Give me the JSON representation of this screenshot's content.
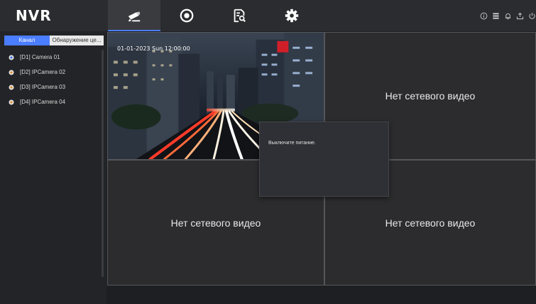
{
  "app": {
    "logo": "NVR"
  },
  "nav": {
    "tabs": [
      {
        "name": "live-view",
        "icon": "camera-icon",
        "active": true
      },
      {
        "name": "playback",
        "icon": "playback-icon",
        "active": false
      },
      {
        "name": "search",
        "icon": "file-search-icon",
        "active": false
      },
      {
        "name": "settings",
        "icon": "gear-icon",
        "active": false
      }
    ],
    "right_icons": [
      "info-icon",
      "monitor-icon",
      "bell-icon",
      "export-icon",
      "power-icon"
    ]
  },
  "sidebar": {
    "tab_channel": "Канал",
    "tab_detection": "Обнаружение це...",
    "cameras": [
      "[D1] Camera 01",
      "[D2] IPCamera 02",
      "[D3] IPCamera 03",
      "[D4] IPCamera 04"
    ]
  },
  "grid": {
    "live_osd": "01-01-2023 Sun 12:00:00",
    "no_video_1": "Нет сетевого видео",
    "no_video_2": "Нет сетевого видео",
    "no_video_3": "Нет сетевого видео"
  },
  "popup": {
    "message": "Выключите питание."
  },
  "colors": {
    "accent": "#4a7dff",
    "background": "#1e1f22",
    "cell_border": "#55565a"
  }
}
